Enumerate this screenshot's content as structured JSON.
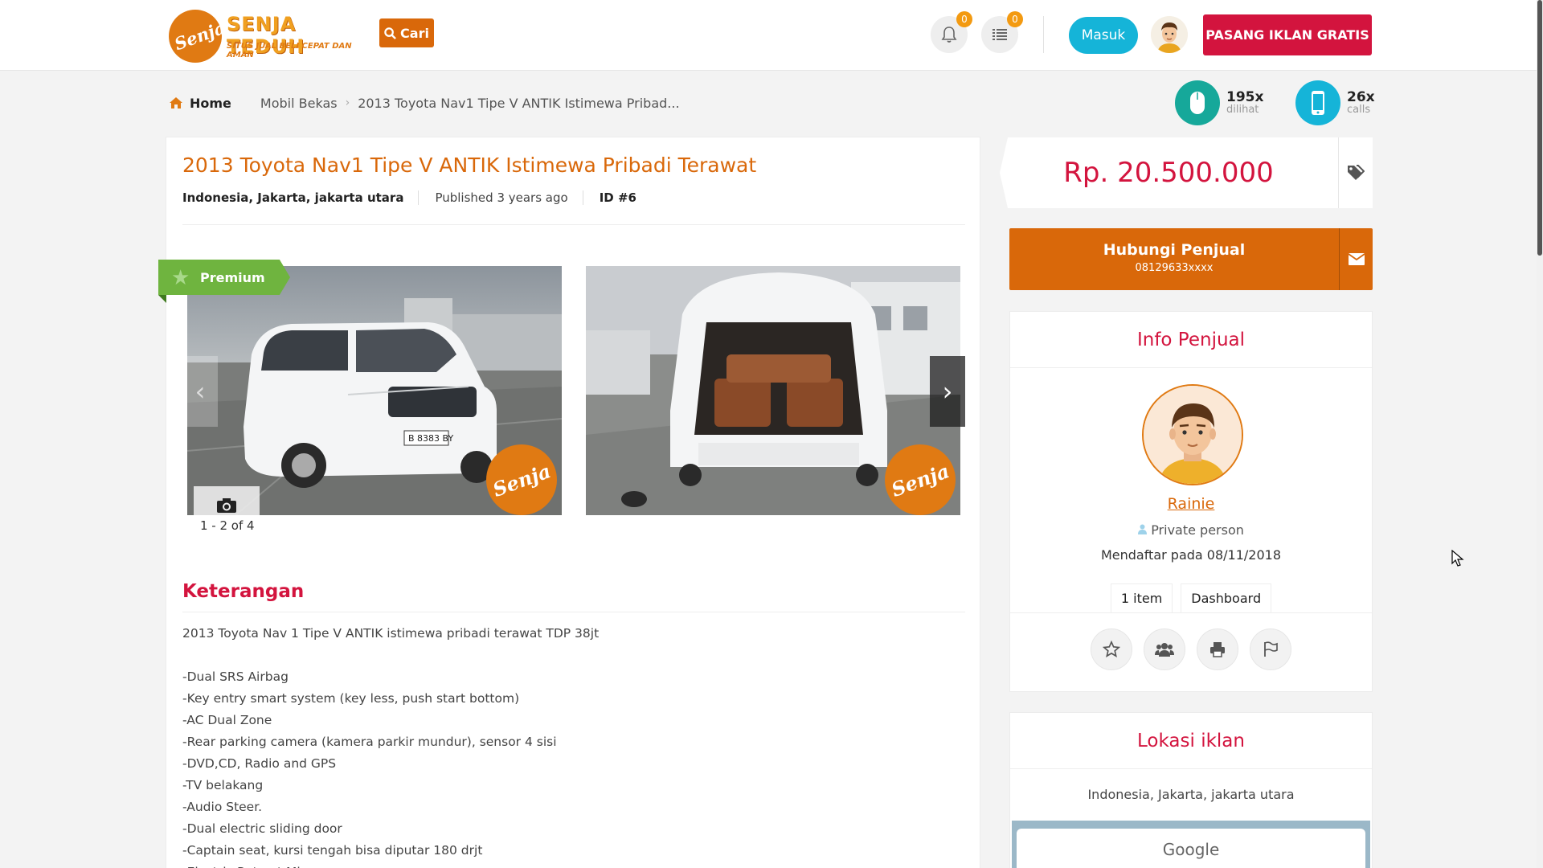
{
  "header": {
    "logo_name": "SENJA TEDUH",
    "logo_tagline": "SITUS JUAL BELI CEPAT DAN AMAN",
    "logo_mark": "Senja",
    "search_label": "Cari",
    "notifications_count": "0",
    "list_count": "0",
    "login_label": "Masuk",
    "post_ad_label": "PASANG IKLAN GRATIS"
  },
  "breadcrumb": {
    "home": "Home",
    "category": "Mobil Bekas",
    "current": "2013 Toyota Nav1 Tipe V ANTIK Istimewa Pribad..."
  },
  "stats": {
    "views_count": "195x",
    "views_label": "dilihat",
    "calls_count": "26x",
    "calls_label": "calls"
  },
  "listing": {
    "title": "2013 Toyota Nav1 Tipe V ANTIK Istimewa Pribadi Terawat",
    "location": "Indonesia, Jakarta, jakarta utara",
    "published": "Published 3 years ago",
    "id": "ID #6",
    "badge": "Premium",
    "photo_count": "1 - 2 of 4",
    "watermark": "Senja",
    "description_title": "Keterangan",
    "description_lines": [
      "2013 Toyota Nav 1 Tipe V ANTIK istimewa pribadi terawat TDP 38jt",
      "",
      "-Dual SRS Airbag",
      "-Key entry smart system (key less, push start bottom)",
      "-AC Dual Zone",
      "-Rear parking camera (kamera parkir mundur), sensor 4 sisi",
      "-DVD,CD, Radio and GPS",
      "-TV belakang",
      "-Audio Steer.",
      "-Dual electric sliding door",
      "-Captain seat, kursi tengah bisa diputar 180 drjt",
      "-Electric Retract Mirror"
    ]
  },
  "price": "Rp. 20.500.000",
  "contact": {
    "title": "Hubungi Penjual",
    "phone": "08129633xxxx"
  },
  "seller": {
    "section_title": "Info Penjual",
    "name": "Rainie",
    "type": "Private person",
    "since": "Mendaftar pada 08/11/2018",
    "tab_items": "1 item",
    "tab_dashboard": "Dashboard"
  },
  "location": {
    "section_title": "Lokasi iklan",
    "text": "Indonesia, Jakarta, jakarta utara",
    "map_brand": "Google"
  },
  "colors": {
    "accent_orange": "#d9680a",
    "accent_red": "#d3143e",
    "accent_cyan": "#15b4d8",
    "premium_green": "#6fb43f",
    "views_teal": "#16a89a"
  }
}
